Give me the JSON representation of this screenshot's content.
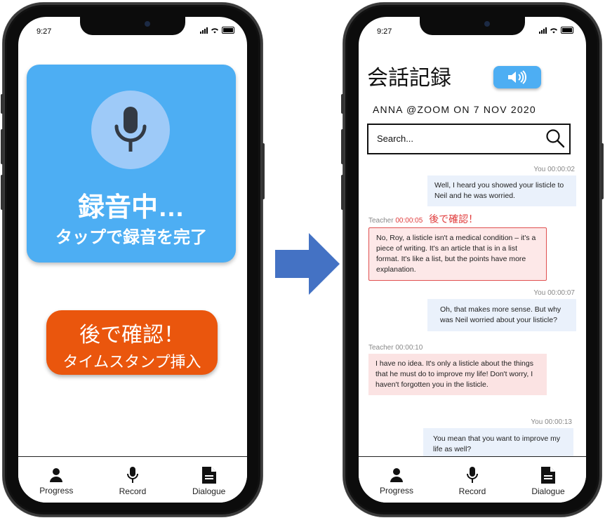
{
  "status": {
    "time": "9:27"
  },
  "recorder": {
    "title": "録音中…",
    "subtitle": "タップで録音を完了"
  },
  "later_button": {
    "title": "後で確認！",
    "subtitle": "タイムスタンプ挿入"
  },
  "nav": {
    "items": [
      {
        "label": "Progress",
        "icon": "person-icon"
      },
      {
        "label": "Record",
        "icon": "mic-icon"
      },
      {
        "label": "Dialogue",
        "icon": "document-icon"
      }
    ]
  },
  "conversation": {
    "title": "会話記録",
    "meta": "ANNA  @ZOOM ON 7 NOV 2020",
    "search_placeholder": "Search...",
    "messages": [
      {
        "speaker": "You",
        "time": "00:00:02",
        "text": "Well, I heard you showed your listicle to Neil and he was worried."
      },
      {
        "speaker": "Teacher",
        "time": "00:00:05",
        "flag": "後で確認！",
        "text": "No, Roy, a listicle isn't a medical condition – it's a piece of writing. It's an article that is in a list format. It's like a list, but the points have more explanation."
      },
      {
        "speaker": "You",
        "time": "00:00:07",
        "text": "Oh, that makes more sense. But why was Neil worried about your listicle?"
      },
      {
        "speaker": "Teacher",
        "time": "00:00:10",
        "text": "I have no idea. It's only a listicle about the things that he must do to improve my life! Don't worry, I haven't forgotten you in the listicle."
      },
      {
        "speaker": "You",
        "time": "00:00:13",
        "text": "You mean that you want to improve my life as well?"
      }
    ]
  },
  "colors": {
    "accent_blue": "#4daef3",
    "accent_orange": "#ea560d",
    "flag_red": "#e03b3b",
    "arrow_blue": "#4472c4"
  }
}
